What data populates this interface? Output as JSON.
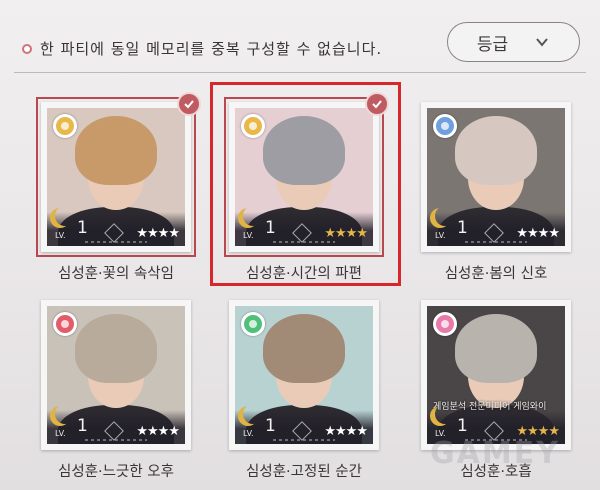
{
  "header": {
    "notice": "한 파티에 동일 메모리를 중복 구성할 수 없습니다.",
    "sort_label": "등급"
  },
  "cards": [
    {
      "name": "심성훈·꽃의 속삭임",
      "level": "1",
      "lv_label": "LV.",
      "stars": 4,
      "star_color": "#ffffff",
      "attribute_color": "#e8b94a",
      "selected": true,
      "hair": "#c89a6a",
      "bg": "#d8c8bf"
    },
    {
      "name": "심성훈·시간의 파편",
      "level": "1",
      "lv_label": "LV.",
      "stars": 4,
      "star_color": "#e4b54a",
      "attribute_color": "#e8b94a",
      "selected": true,
      "hair": "#9d9da3",
      "bg": "#e5cfd3"
    },
    {
      "name": "심성훈·봄의 신호",
      "level": "1",
      "lv_label": "LV.",
      "stars": 4,
      "star_color": "#ffffff",
      "attribute_color": "#6fa0e0",
      "selected": false,
      "hair": "#d6c8c0",
      "bg": "#7c7672"
    },
    {
      "name": "심성훈·느긋한 오후",
      "level": "1",
      "lv_label": "LV.",
      "stars": 4,
      "star_color": "#ffffff",
      "attribute_color": "#e25c6a",
      "selected": false,
      "hair": "#b9ab9c",
      "bg": "#c9c2b9"
    },
    {
      "name": "심성훈·고정된 순간",
      "level": "1",
      "lv_label": "LV.",
      "stars": 4,
      "star_color": "#ffffff",
      "attribute_color": "#4fbf7a",
      "selected": false,
      "hair": "#a28b76",
      "bg": "#b8d2d2"
    },
    {
      "name": "심성훈·호흡",
      "level": "1",
      "lv_label": "LV.",
      "stars": 4,
      "star_color": "#e4b54a",
      "attribute_color": "#e77aa8",
      "selected": false,
      "hair": "#b9b3ae",
      "bg": "#4a4648",
      "caption": "게임분석 전문미디어 게임와이"
    }
  ],
  "watermark": "GAMEY"
}
